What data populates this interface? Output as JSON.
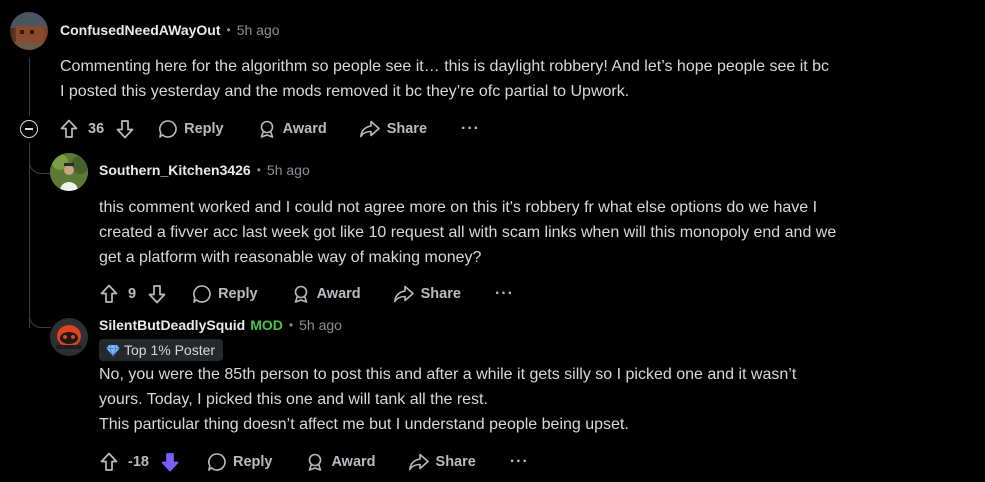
{
  "comments": [
    {
      "username": "ConfusedNeedAWayOut",
      "timestamp": "5h ago",
      "body": [
        "Commenting here for the algorithm so people see it… this is daylight robbery! And let’s hope people see it bc",
        "I posted this yesterday and the mods removed it bc they’re ofc partial to Upwork."
      ],
      "score": "36",
      "reply_label": "Reply",
      "award_label": "Award",
      "share_label": "Share",
      "more_label": "···"
    },
    {
      "username": "Southern_Kitchen3426",
      "timestamp": "5h ago",
      "body": [
        "this comment worked and I could not agree more on this it's robbery fr what else options do we have I",
        "created a fivver acc last week got like 10 request all with scam links when will this monopoly end and we",
        "get a platform with reasonable way of making money?"
      ],
      "score": "9",
      "reply_label": "Reply",
      "award_label": "Award",
      "share_label": "Share",
      "more_label": "···"
    },
    {
      "username": "SilentButDeadlySquid",
      "mod_label": "MOD",
      "timestamp": "5h ago",
      "flair": "Top 1% Poster",
      "body": [
        "No, you were the 85th person to post this and after a while it gets silly so I picked one and it wasn’t",
        "yours. Today, I picked this one and will tank all the rest.",
        "This particular thing doesn’t affect me but I understand people being upset."
      ],
      "score": "-18",
      "downvoted": true,
      "reply_label": "Reply",
      "award_label": "Award",
      "share_label": "Share",
      "more_label": "···"
    }
  ],
  "colors": {
    "background": "#000000",
    "mod": "#47c44a",
    "downvote_active": "#7b5cff"
  }
}
